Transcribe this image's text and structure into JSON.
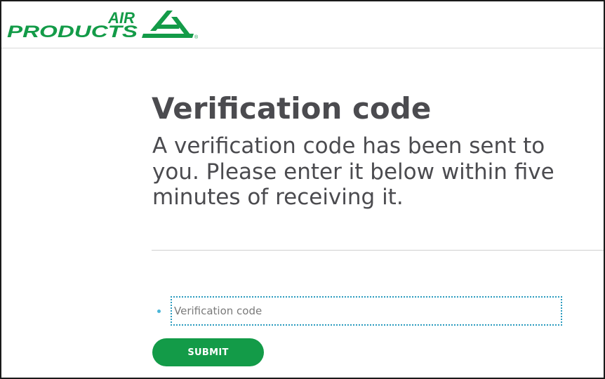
{
  "header": {
    "logo": {
      "line1": "AIR",
      "line2": "PRODUCTS",
      "brand_color": "#139b48",
      "icon": "air-products-logo-mark"
    }
  },
  "main": {
    "title": "Verification code",
    "description": "A verification code has been sent to you. Please enter it below within five minutes of receiving it.",
    "input": {
      "value": "",
      "placeholder": "Verification code"
    },
    "submit_label": "SUBMIT"
  },
  "colors": {
    "accent": "#139b48",
    "text": "#4b4b4f",
    "focus_border": "#2a9bbf"
  }
}
